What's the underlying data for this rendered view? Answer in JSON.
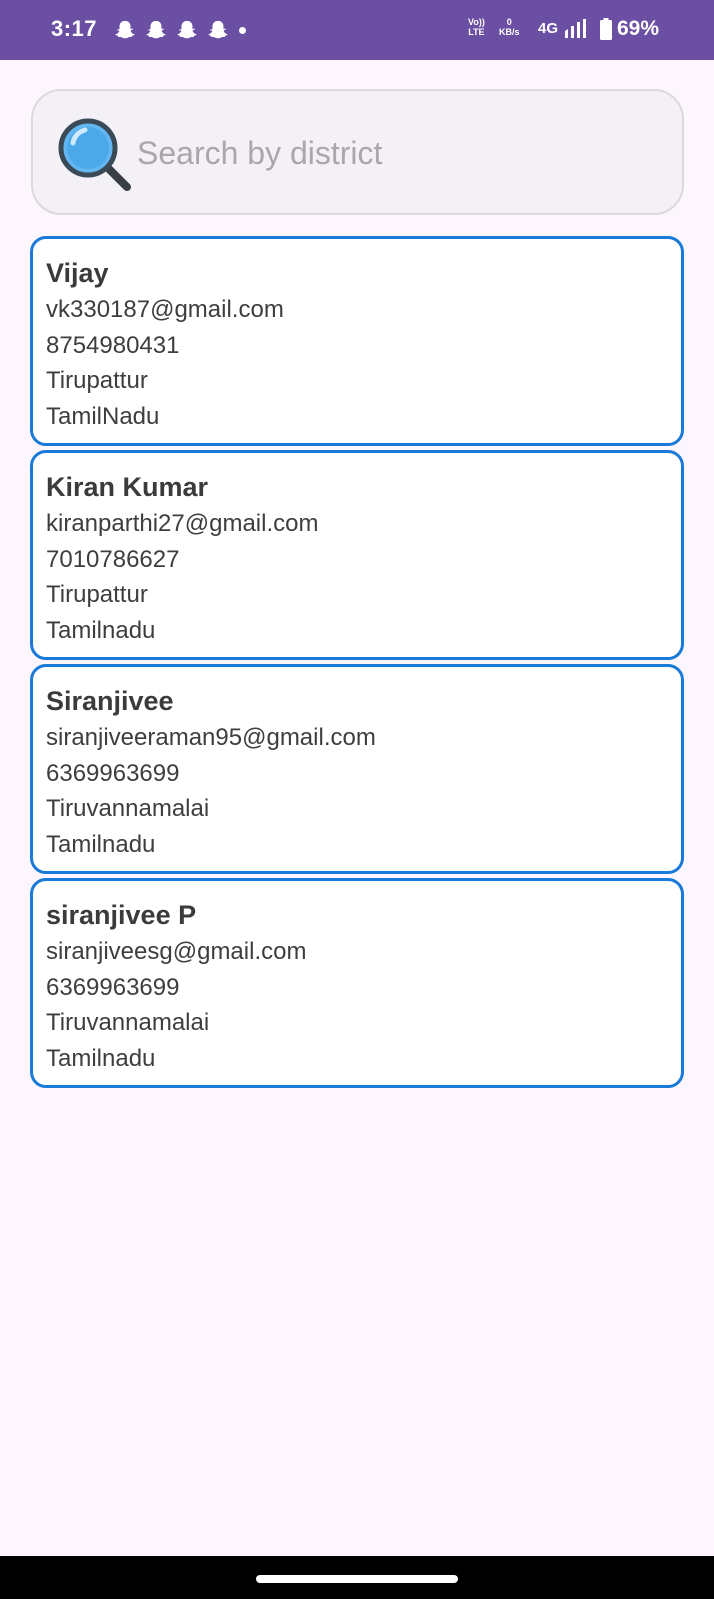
{
  "status_bar": {
    "time": "3:17",
    "notification_icons": [
      "snapchat-icon",
      "snapchat-icon",
      "snapchat-icon",
      "snapchat-icon"
    ],
    "volte_top": "Vo))",
    "volte_bottom": "LTE",
    "speed_value": "0",
    "speed_unit": "KB/s",
    "network": "4G",
    "battery": "69%"
  },
  "search": {
    "placeholder": "Search by district",
    "value": "",
    "icon": "magnifier-icon"
  },
  "contacts": [
    {
      "name": "Vijay",
      "email": "vk330187@gmail.com",
      "phone": "8754980431",
      "district": "Tirupattur",
      "state": "TamilNadu"
    },
    {
      "name": "Kiran Kumar",
      "email": "kiranparthi27@gmail.com",
      "phone": "7010786627",
      "district": "Tirupattur",
      "state": "Tamilnadu"
    },
    {
      "name": "Siranjivee",
      "email": "siranjiveeraman95@gmail.com",
      "phone": "6369963699",
      "district": "Tiruvannamalai",
      "state": "Tamilnadu"
    },
    {
      "name": "siranjivee P",
      "email": "siranjiveesg@gmail.com",
      "phone": "6369963699",
      "district": "Tiruvannamalai",
      "state": "Tamilnadu"
    }
  ],
  "colors": {
    "status_bar": "#6a4fa3",
    "background": "#fdf6fe",
    "card_border": "#1a7ad8",
    "search_background": "#f4f1f6"
  }
}
